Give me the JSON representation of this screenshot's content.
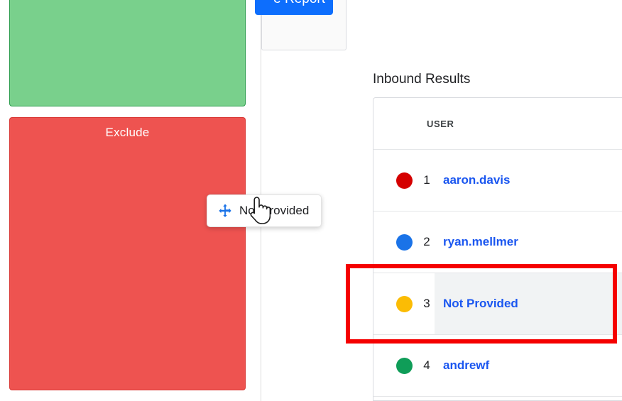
{
  "left_panel": {
    "dropzones": [
      {
        "key": "include",
        "label": "",
        "color": "#79d08c",
        "border_color": "#2e9e4f"
      },
      {
        "key": "exclude",
        "label": "Exclude",
        "color": "#ee5350",
        "border_color": "#d93b38"
      }
    ]
  },
  "report_card": {
    "create_report_label": "e Report",
    "button_color": "#0d6efd"
  },
  "drag_chip": {
    "icon": "move-icon",
    "label": "Not Provided"
  },
  "cursor": {
    "icon": "pointer-hand-cursor"
  },
  "results": {
    "title": "Inbound Results",
    "columns": [
      "USER"
    ],
    "rows": [
      {
        "dot_color": "#d50000",
        "rank": "1",
        "user": "aaron.davis",
        "active": false
      },
      {
        "dot_color": "#1a73e8",
        "rank": "2",
        "user": "ryan.mellmer",
        "active": false
      },
      {
        "dot_color": "#fbbc04",
        "rank": "3",
        "user": "Not Provided",
        "active": true
      },
      {
        "dot_color": "#0f9d58",
        "rank": "4",
        "user": "andrewf",
        "active": false
      }
    ]
  },
  "annotation": {
    "color": "#f50000",
    "target_row_rank": "3"
  }
}
